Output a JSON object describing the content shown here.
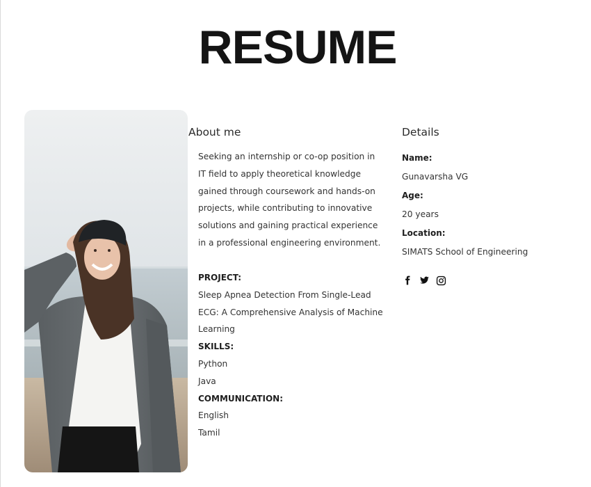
{
  "page": {
    "title": "RESUME"
  },
  "about": {
    "heading": "About me",
    "lines": [
      "Seeking an internship or co-op position in",
      "IT field to apply theoretical knowledge",
      "gained through coursework and hands-on",
      "projects, while contributing to innovative",
      "solutions and gaining practical experience",
      "in a professional engineering environment."
    ]
  },
  "project": {
    "label": "PROJECT:",
    "lines": [
      "Sleep Apnea Detection From Single-Lead",
      "ECG: A Comprehensive Analysis of Machine",
      "Learning"
    ]
  },
  "skills": {
    "label": "SKILLS:",
    "items": [
      "Python",
      "Java"
    ]
  },
  "communication": {
    "label": "COMMUNICATION:",
    "items": [
      "English",
      "Tamil"
    ]
  },
  "details": {
    "heading": "Details",
    "name_label": "Name:",
    "name_value": "Gunavarsha VG",
    "age_label": "Age:",
    "age_value": "20 years",
    "location_label": "Location:",
    "location_value": "SIMATS School of Engineering"
  },
  "social": {
    "icons": [
      "facebook-icon",
      "twitter-icon",
      "instagram-icon"
    ]
  },
  "colors": {
    "title": "#141414",
    "text": "#333333",
    "cardigan": "#5f6467",
    "shirt": "#f3f3f1",
    "sky": "#e9ecee",
    "sea": "#b9c3c8"
  }
}
